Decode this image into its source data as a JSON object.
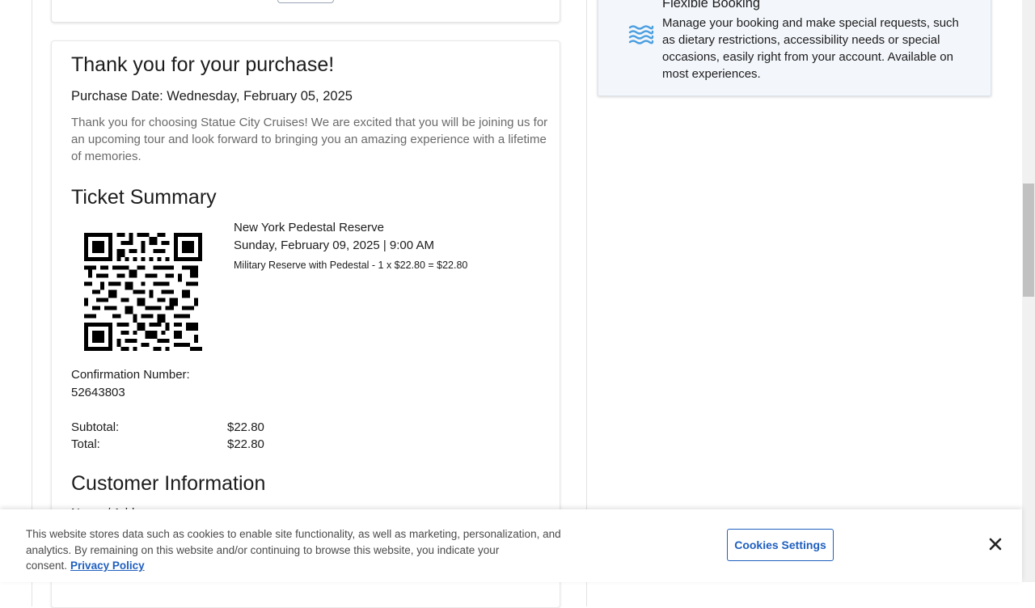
{
  "confirmation": {
    "title": "Thank you for your purchase!",
    "purchase_date": "Purchase Date: Wednesday, February 05, 2025",
    "intro": "Thank you for choosing Statue City Cruises! We are excited that you will be joining us for an upcoming tour and look forward to bringing you an amazing experience with a lifetime of memories."
  },
  "ticket_summary": {
    "title": "Ticket Summary",
    "event_name": "New York Pedestal Reserve",
    "event_date": "Sunday, February 09, 2025 | 9:00 AM",
    "line_item": "Military Reserve with Pedestal - 1 x $22.80 = $22.80",
    "confirmation_label": "Confirmation Number:",
    "confirmation_number": "52643803",
    "subtotal_label": "Subtotal:",
    "subtotal_value": "$22.80",
    "total_label": "Total:",
    "total_value": "$22.80"
  },
  "customer_info": {
    "title": "Customer Information",
    "first_field_label": "Name / Address"
  },
  "flexible_booking": {
    "title": "Flexible Booking",
    "text": "Manage your booking and make special requests, such as dietary restrictions, accessibility needs or special occasions, easily right from your account. Available on most experiences.",
    "icon": "waves-icon",
    "icon_color": "#4a9fe0"
  },
  "cookie_banner": {
    "text": "This website stores data such as cookies to enable site functionality, as well as marketing, personalization, and analytics. By remaining on this website and/or continuing to browse this website, you indicate your consent.",
    "privacy_link": "Privacy Policy",
    "settings_button": "Cookies Settings",
    "close_icon": "close-icon",
    "accent_color": "#1f5fbf"
  }
}
